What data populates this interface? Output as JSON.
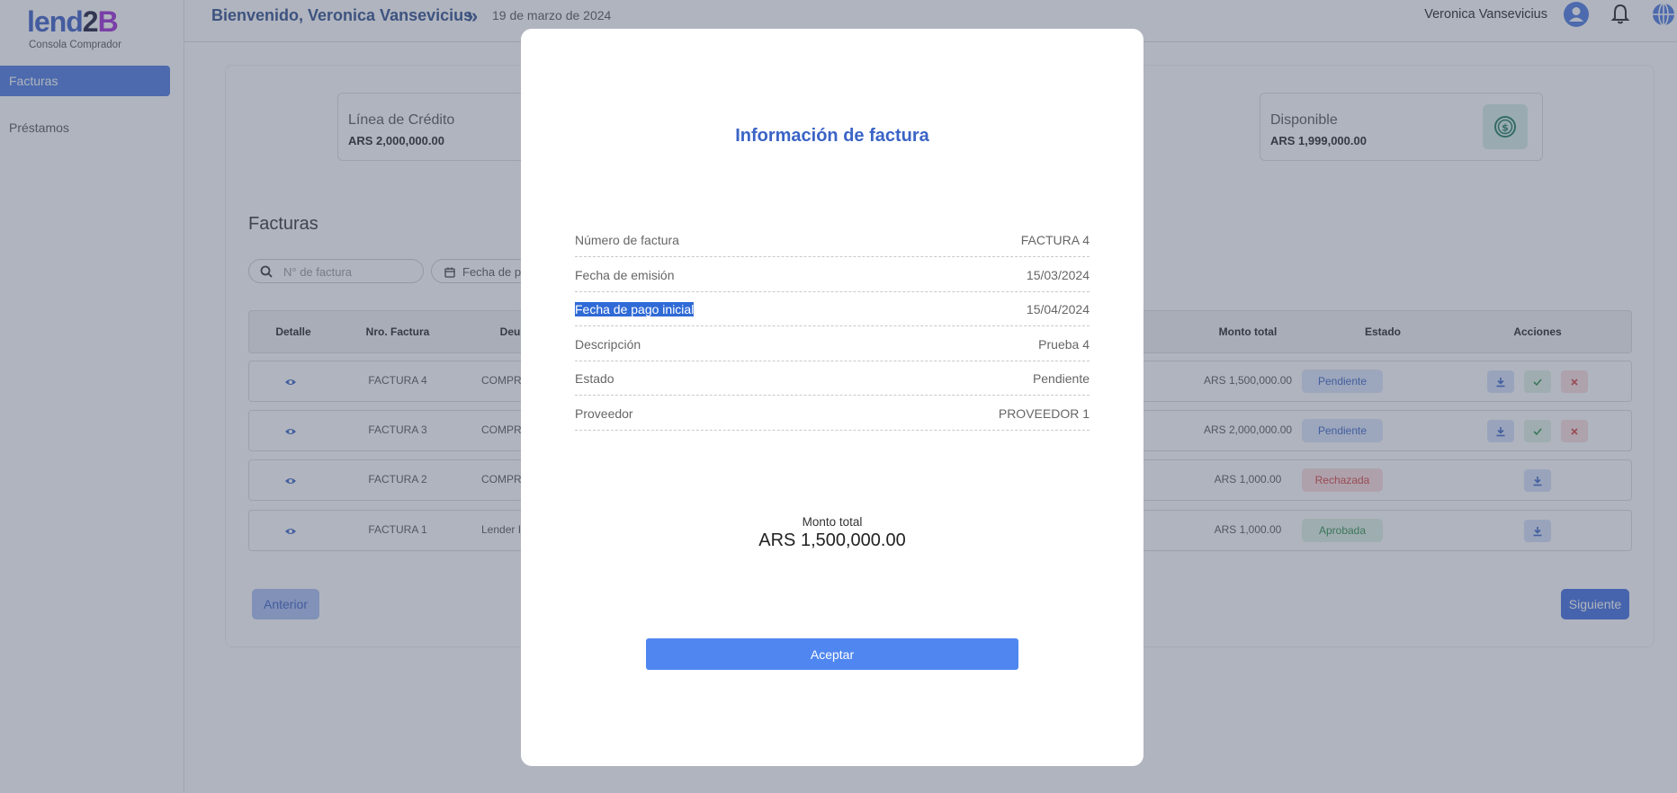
{
  "colors": {
    "primary": "#4a78e0",
    "title_blue": "#3a64c6",
    "pending_bg": "#dbe5fb",
    "rejected_text": "#d6413f",
    "approved_text": "#2f8f4e",
    "overlay": "rgba(80,88,110,0.45)"
  },
  "sidebar": {
    "logo_parts": [
      "lend",
      "2",
      "B"
    ],
    "logo_subtitle": "Consola Comprador",
    "items": [
      {
        "label": "Facturas",
        "active": true
      },
      {
        "label": "Préstamos",
        "active": false
      }
    ]
  },
  "header": {
    "welcome": "Bienvenido, Veronica Vansevicius",
    "chevron": "»",
    "date": "19 de marzo de 2024",
    "user_name": "Veronica Vansevicius",
    "icons": [
      "user-icon",
      "bell-icon",
      "globe-icon"
    ]
  },
  "stats": [
    {
      "title": "Línea de Crédito",
      "value": "ARS 2,000,000.00"
    },
    {
      "title": "Disponible",
      "value": "ARS 1,999,000.00",
      "icon": "dollar-circle-icon"
    }
  ],
  "invoices_section": {
    "title": "Facturas",
    "search_placeholder": "N° de factura",
    "date_filter_placeholder": "Fecha de p",
    "columns": [
      "Detalle",
      "Nro. Factura",
      "Deu",
      "Monto total",
      "Estado",
      "Acciones"
    ],
    "rows": [
      {
        "number": "FACTURA 4",
        "debtor": "COMPRA",
        "amount": "ARS 1,500,000.00",
        "status": "Pendiente",
        "status_kind": "pend",
        "actions": [
          "download",
          "approve",
          "reject"
        ]
      },
      {
        "number": "FACTURA 3",
        "debtor": "COMPRA",
        "amount": "ARS 2,000,000.00",
        "status": "Pendiente",
        "status_kind": "pend",
        "actions": [
          "download",
          "approve",
          "reject"
        ]
      },
      {
        "number": "FACTURA 2",
        "debtor": "COMPRA",
        "amount": "ARS 1,000.00",
        "status": "Rechazada",
        "status_kind": "rech",
        "actions": [
          "download"
        ]
      },
      {
        "number": "FACTURA 1",
        "debtor": "Lender I",
        "amount": "ARS 1,000.00",
        "status": "Aprobada",
        "status_kind": "apr",
        "actions": [
          "download"
        ]
      }
    ],
    "prev_label": "Anterior",
    "next_label": "Siguiente"
  },
  "modal": {
    "title": "Información de factura",
    "fields": [
      {
        "label": "Número de factura",
        "value": "FACTURA 4"
      },
      {
        "label": "Fecha de emisión",
        "value": "15/03/2024"
      },
      {
        "label": "Fecha de pago inicial",
        "value": "15/04/2024"
      },
      {
        "label": "Descripción",
        "value": "Prueba 4"
      },
      {
        "label": "Estado",
        "value": "Pendiente"
      },
      {
        "label": "Proveedor",
        "value": "PROVEEDOR 1"
      }
    ],
    "total_label": "Monto total",
    "total_value": "ARS 1,500,000.00",
    "accept_label": "Aceptar"
  }
}
